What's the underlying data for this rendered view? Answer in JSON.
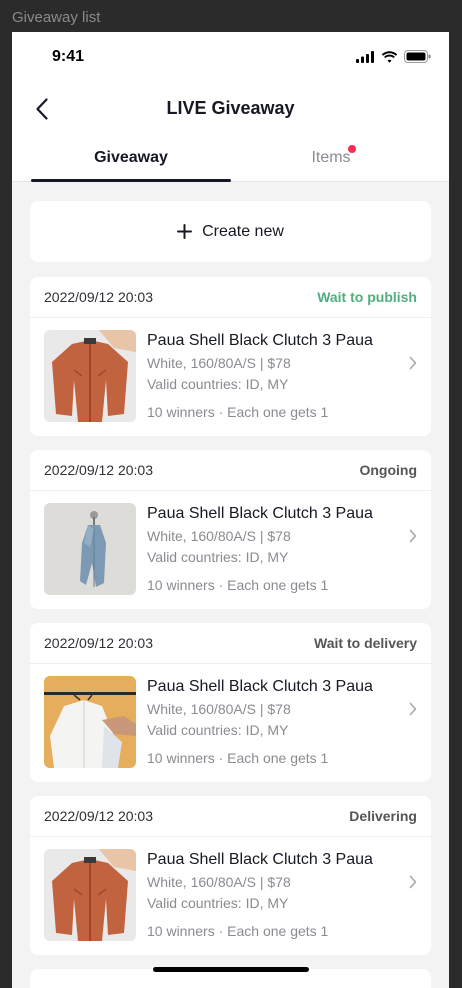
{
  "frame_label": "Giveaway list",
  "status_bar": {
    "time": "9:41"
  },
  "nav": {
    "title": "LIVE Giveaway",
    "back_icon": "chevron-left-icon"
  },
  "tabs": [
    {
      "label": "Giveaway",
      "active": true
    },
    {
      "label": "Items",
      "active": false,
      "badge_dot": true
    }
  ],
  "create_button": {
    "label": "Create new",
    "icon": "plus-icon"
  },
  "colors": {
    "accent_red": "#fe2c55",
    "status_green": "#4fae7d",
    "text_primary": "#161823",
    "text_secondary": "#8a8b91"
  },
  "giveaways": [
    {
      "time": "2022/09/12 20:03",
      "status": "Wait to publish",
      "status_color": "#4fae7d",
      "product": "Paua Shell Black Clutch 3 Paua",
      "variant": "White, 160/80A/S  | $78",
      "countries": "Valid countries: ID, MY",
      "winners": "10 winners · Each one gets 1",
      "image": "orange-jacket"
    },
    {
      "time": "2022/09/12 20:03",
      "status": "Ongoing",
      "status_color": "#555555",
      "product": "Paua Shell Black Clutch 3 Paua",
      "variant": "White, 160/80A/S  | $78",
      "countries": "Valid countries: ID, MY",
      "winners": "10 winners · Each one gets 1",
      "image": "denim-jacket"
    },
    {
      "time": "2022/09/12 20:03",
      "status": "Wait to delivery",
      "status_color": "#555555",
      "product": "Paua Shell Black Clutch 3 Paua",
      "variant": "White, 160/80A/S  | $78",
      "countries": "Valid countries: ID, MY",
      "winners": "10 winners · Each one gets 1",
      "image": "white-shirt"
    },
    {
      "time": "2022/09/12 20:03",
      "status": "Delivering",
      "status_color": "#555555",
      "product": "Paua Shell Black Clutch 3 Paua",
      "variant": "White, 160/80A/S  | $78",
      "countries": "Valid countries: ID, MY",
      "winners": "10 winners · Each one gets 1",
      "image": "orange-jacket"
    }
  ]
}
